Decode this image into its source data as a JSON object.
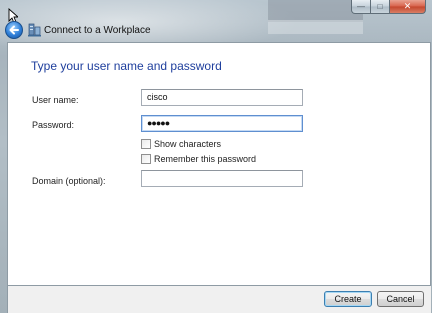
{
  "window": {
    "title": "Connect to a Workplace",
    "caption_buttons": {
      "minimize": "—",
      "maximize": "□",
      "close": "✕"
    }
  },
  "dialog": {
    "heading": "Type your user name and password",
    "fields": {
      "username": {
        "label": "User name:",
        "value": "cisco"
      },
      "password": {
        "label": "Password:",
        "value": "●●●●●"
      },
      "domain": {
        "label": "Domain (optional):",
        "value": ""
      }
    },
    "checkboxes": {
      "show_characters": {
        "label": "Show characters",
        "checked": false
      },
      "remember_password": {
        "label": "Remember this password",
        "checked": false
      }
    }
  },
  "footer": {
    "create_label": "Create",
    "cancel_label": "Cancel"
  },
  "colors": {
    "heading": "#1f3f9d",
    "frame": "#b2bec6",
    "close_button": "#c3452c"
  },
  "icons": {
    "back": "back-arrow-icon",
    "wizard": "network-workplace-icon",
    "cursor": "mouse-pointer-icon"
  }
}
